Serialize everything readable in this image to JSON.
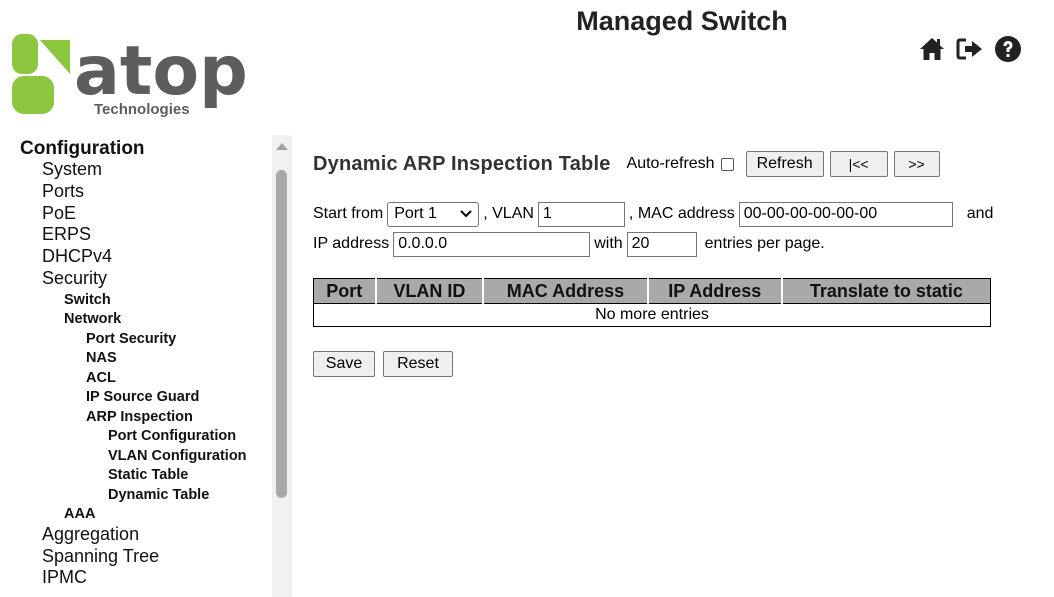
{
  "header": {
    "title": "Managed Switch",
    "logo_text": "atop",
    "logo_subtext": "Technologies",
    "icons": [
      "home-icon",
      "logout-icon",
      "help-icon"
    ]
  },
  "colors": {
    "logo_green": "#8dc63f",
    "logo_gray": "#5d5d5d",
    "table_header_bg": "#a9a9a9"
  },
  "sidebar": {
    "items": [
      {
        "label": "Configuration",
        "level": 0
      },
      {
        "label": "System",
        "level": 1
      },
      {
        "label": "Ports",
        "level": 1
      },
      {
        "label": "PoE",
        "level": 1
      },
      {
        "label": "ERPS",
        "level": 1
      },
      {
        "label": "DHCPv4",
        "level": 1
      },
      {
        "label": "Security",
        "level": 1
      },
      {
        "label": "Switch",
        "level": 2
      },
      {
        "label": "Network",
        "level": 2
      },
      {
        "label": "Port Security",
        "level": 3
      },
      {
        "label": "NAS",
        "level": 3
      },
      {
        "label": "ACL",
        "level": 3
      },
      {
        "label": "IP Source Guard",
        "level": 3
      },
      {
        "label": "ARP Inspection",
        "level": 3
      },
      {
        "label": "Port Configuration",
        "level": 4
      },
      {
        "label": "VLAN Configuration",
        "level": 4
      },
      {
        "label": "Static Table",
        "level": 4
      },
      {
        "label": "Dynamic Table",
        "level": 4
      },
      {
        "label": "AAA",
        "level": 2
      },
      {
        "label": "Aggregation",
        "level": 1
      },
      {
        "label": "Spanning Tree",
        "level": 1
      },
      {
        "label": "IPMC",
        "level": 1
      }
    ]
  },
  "main": {
    "title": "Dynamic ARP Inspection Table",
    "auto_refresh_label": "Auto-refresh",
    "auto_refresh_checked": false,
    "refresh_label": "Refresh",
    "first_label": "|<<",
    "next_label": ">>",
    "filters": {
      "start_from_label": "Start from",
      "port_value": "Port 1",
      "vlan_label": ", VLAN",
      "vlan_value": "1",
      "mac_label": ", MAC address",
      "mac_value": "00-00-00-00-00-00",
      "and_label": "and",
      "ip_label": "IP address",
      "ip_value": "0.0.0.0",
      "with_label": "with",
      "entries_value": "20",
      "entries_suffix": "entries per page."
    },
    "table": {
      "headers": [
        "Port",
        "VLAN ID",
        "MAC Address",
        "IP Address",
        "Translate to static"
      ],
      "empty_message": "No more entries"
    },
    "save_label": "Save",
    "reset_label": "Reset"
  }
}
